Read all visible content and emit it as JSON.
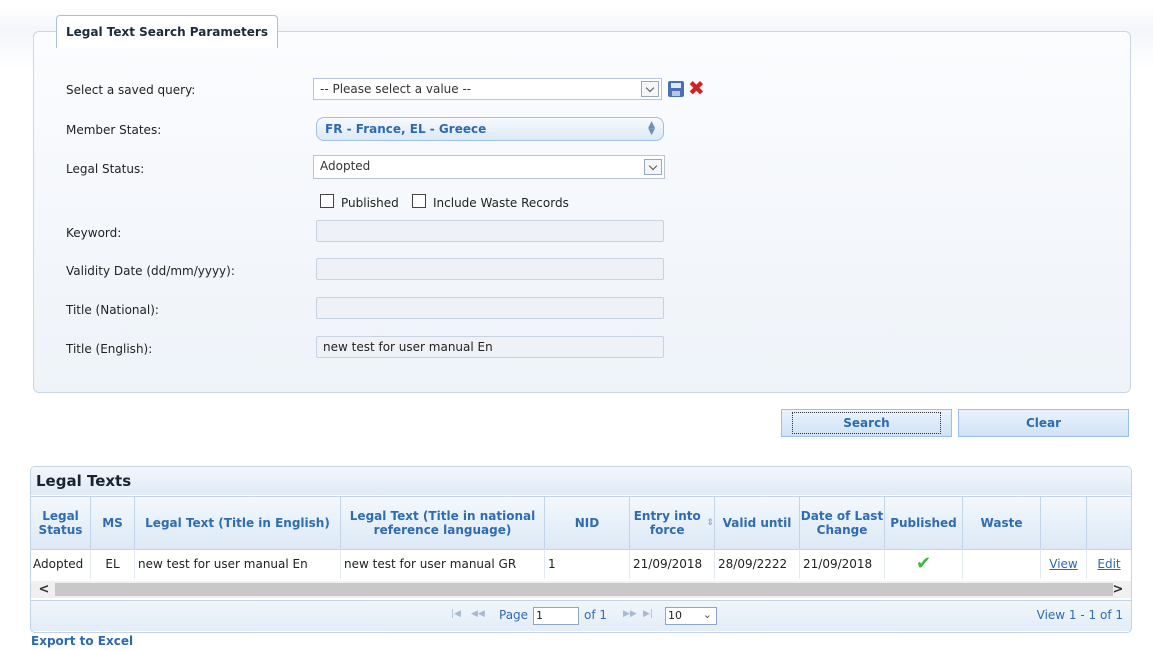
{
  "search_params": {
    "legend": "Legal Text Search Parameters",
    "saved_query_label": "Select a saved query:",
    "saved_query_value": "-- Please select a value --",
    "member_states_label": "Member States:",
    "member_states_value": "FR - France, EL - Greece",
    "legal_status_label": "Legal Status:",
    "legal_status_value": "Adopted",
    "published_label": "Published",
    "include_waste_label": "Include Waste Records",
    "keyword_label": "Keyword:",
    "keyword_value": "",
    "validity_date_label": "Validity Date (dd/mm/yyyy):",
    "validity_date_value": "",
    "title_national_label": "Title (National):",
    "title_national_value": "",
    "title_english_label": "Title (English):",
    "title_english_value": "new test for user manual En"
  },
  "buttons": {
    "search": "Search",
    "clear": "Clear"
  },
  "grid": {
    "title": "Legal Texts",
    "headers": [
      "Legal Status",
      "MS",
      "Legal Text (Title in English)",
      "Legal Text (Title in national reference language)",
      "NID",
      "Entry into force",
      "Valid until",
      "Date of Last Change",
      "Published",
      "Waste",
      "",
      ""
    ],
    "rows": [
      {
        "legal_status": "Adopted",
        "ms": "EL",
        "title_en": "new test for user manual En",
        "title_national": "new test for user manual GR",
        "nid": "1",
        "entry_into_force": "21/09/2018",
        "valid_until": "28/09/2222",
        "last_change": "21/09/2018",
        "published": "✔",
        "waste": "",
        "view": "View",
        "edit": "Edit"
      }
    ],
    "pager": {
      "page_label": "Page",
      "page": "1",
      "of_label": "of 1",
      "page_size": "10",
      "view_info": "View 1 - 1 of 1"
    }
  },
  "export_label": "Export to Excel"
}
